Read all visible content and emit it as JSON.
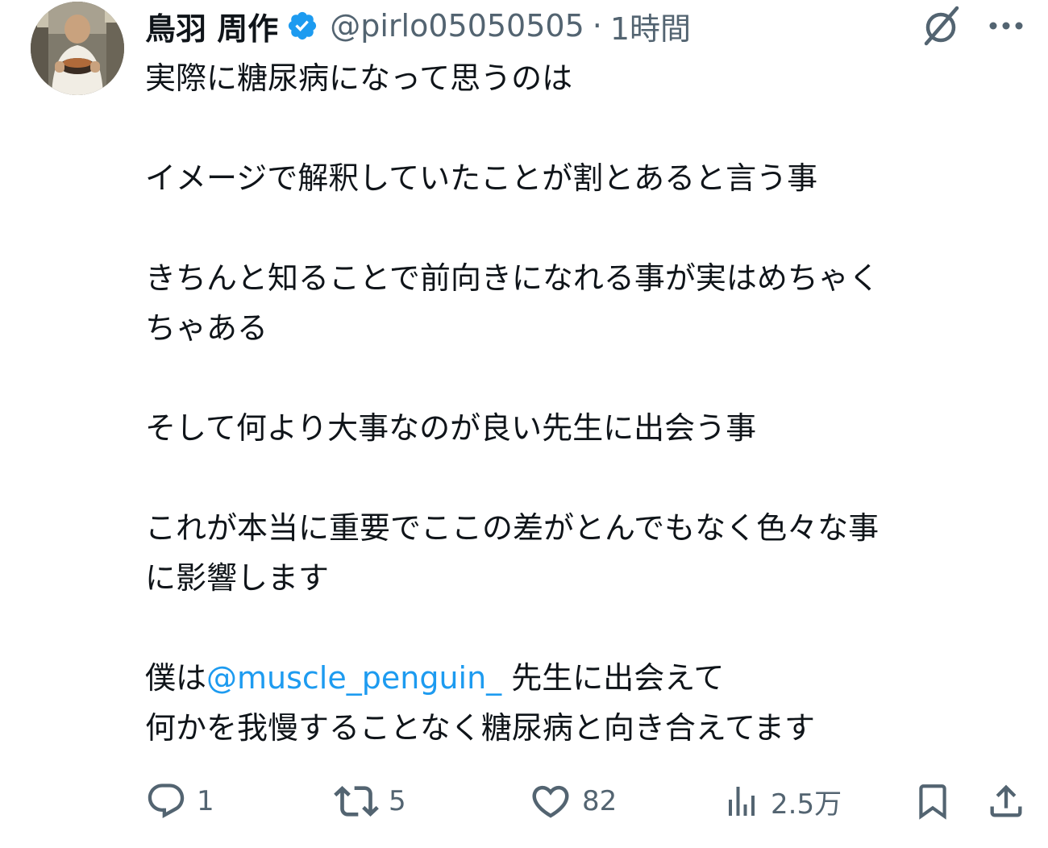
{
  "tweet": {
    "author": {
      "display_name": "鳥羽 周作",
      "verified": true,
      "handle": "@pirlo05050505",
      "separator": "·",
      "time": "1時間"
    },
    "paragraphs": [
      [
        "実際に糖尿病になって思うのは"
      ],
      [
        "イメージで解釈していたことが割とあると言う事"
      ],
      [
        "きちんと知ることで前向きになれる事が実はめちゃく",
        "ちゃある"
      ],
      [
        "そして何より大事なのが良い先生に出会う事"
      ],
      [
        "これが本当に重要でここの差がとんでもなく色々な事",
        "に影響します"
      ]
    ],
    "last_paragraph": {
      "prefix": "僕は",
      "mention": "@muscle_penguin_",
      "suffix": " 先生に出会えて",
      "line2": "何かを我慢することなく糖尿病と向き合えてます"
    },
    "actions": {
      "reply": {
        "icon": "reply-icon",
        "count": "1"
      },
      "retweet": {
        "icon": "retweet-icon",
        "count": "5"
      },
      "like": {
        "icon": "heart-icon",
        "count": "82"
      },
      "views": {
        "icon": "views-icon",
        "count": "2.5万"
      },
      "bookmark": {
        "icon": "bookmark-icon"
      },
      "share": {
        "icon": "share-icon"
      }
    }
  },
  "colors": {
    "text": "#0f1419",
    "secondary": "#536471",
    "accent": "#1d9bf0"
  }
}
